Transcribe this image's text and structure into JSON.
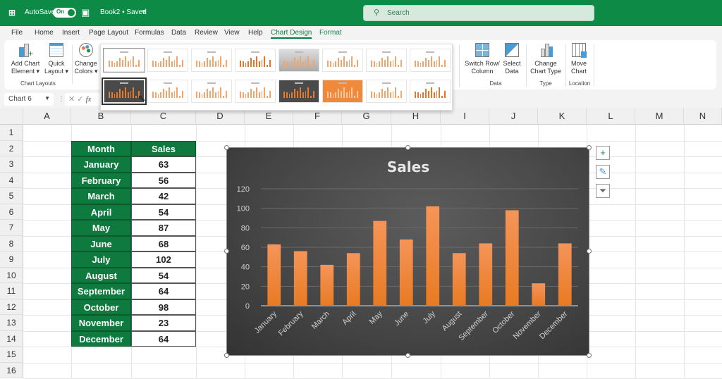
{
  "titlebar": {
    "autosave_label": "AutoSave",
    "toggle_state": "On",
    "doc_title": "Book2 • Saved",
    "search_placeholder": "Search"
  },
  "menu": [
    "File",
    "Home",
    "Insert",
    "Page Layout",
    "Formulas",
    "Data",
    "Review",
    "View",
    "Help",
    "Chart Design",
    "Format"
  ],
  "active_menu": "Chart Design",
  "ribbon": {
    "add_chart_element": [
      "Add Chart",
      "Element ▾"
    ],
    "quick_layout": [
      "Quick",
      "Layout ▾"
    ],
    "change_colors": [
      "Change",
      "Colors ▾"
    ],
    "group_chart_layouts": "Chart Layouts",
    "switch_row_col": [
      "Switch Row/",
      "Column"
    ],
    "select_data": [
      "Select",
      "Data"
    ],
    "group_data": "Data",
    "change_chart_type": [
      "Change",
      "Chart Type"
    ],
    "group_type": "Type",
    "move_chart": [
      "Move",
      "Chart"
    ],
    "group_location": "Location"
  },
  "formula_bar": {
    "name_box": "Chart 6",
    "fx": "fx"
  },
  "columns": [
    "A",
    "B",
    "C",
    "D",
    "E",
    "F",
    "G",
    "H",
    "I",
    "J",
    "K",
    "L",
    "M",
    "N"
  ],
  "rows": [
    "1",
    "2",
    "3",
    "4",
    "5",
    "6",
    "7",
    "8",
    "9",
    "10",
    "11",
    "12",
    "13",
    "14",
    "15",
    "16"
  ],
  "table": {
    "headers": [
      "Month",
      "Sales"
    ],
    "rows": [
      [
        "January",
        "63"
      ],
      [
        "February",
        "56"
      ],
      [
        "March",
        "42"
      ],
      [
        "April",
        "54"
      ],
      [
        "May",
        "87"
      ],
      [
        "June",
        "68"
      ],
      [
        "July",
        "102"
      ],
      [
        "August",
        "54"
      ],
      [
        "September",
        "64"
      ],
      [
        "October",
        "98"
      ],
      [
        "November",
        "23"
      ],
      [
        "December",
        "64"
      ]
    ]
  },
  "chart_data": {
    "type": "bar",
    "title": "Sales",
    "categories": [
      "January",
      "February",
      "March",
      "April",
      "May",
      "June",
      "July",
      "August",
      "September",
      "October",
      "November",
      "December"
    ],
    "values": [
      63,
      56,
      42,
      54,
      87,
      68,
      102,
      54,
      64,
      98,
      23,
      64
    ],
    "yticks": [
      0,
      20,
      40,
      60,
      80,
      100,
      120
    ],
    "ylim": [
      0,
      120
    ],
    "xlabel": "",
    "ylabel": "",
    "grid": true,
    "legend": "none",
    "bar_color": "#ee7f2e",
    "background": "#474747"
  }
}
